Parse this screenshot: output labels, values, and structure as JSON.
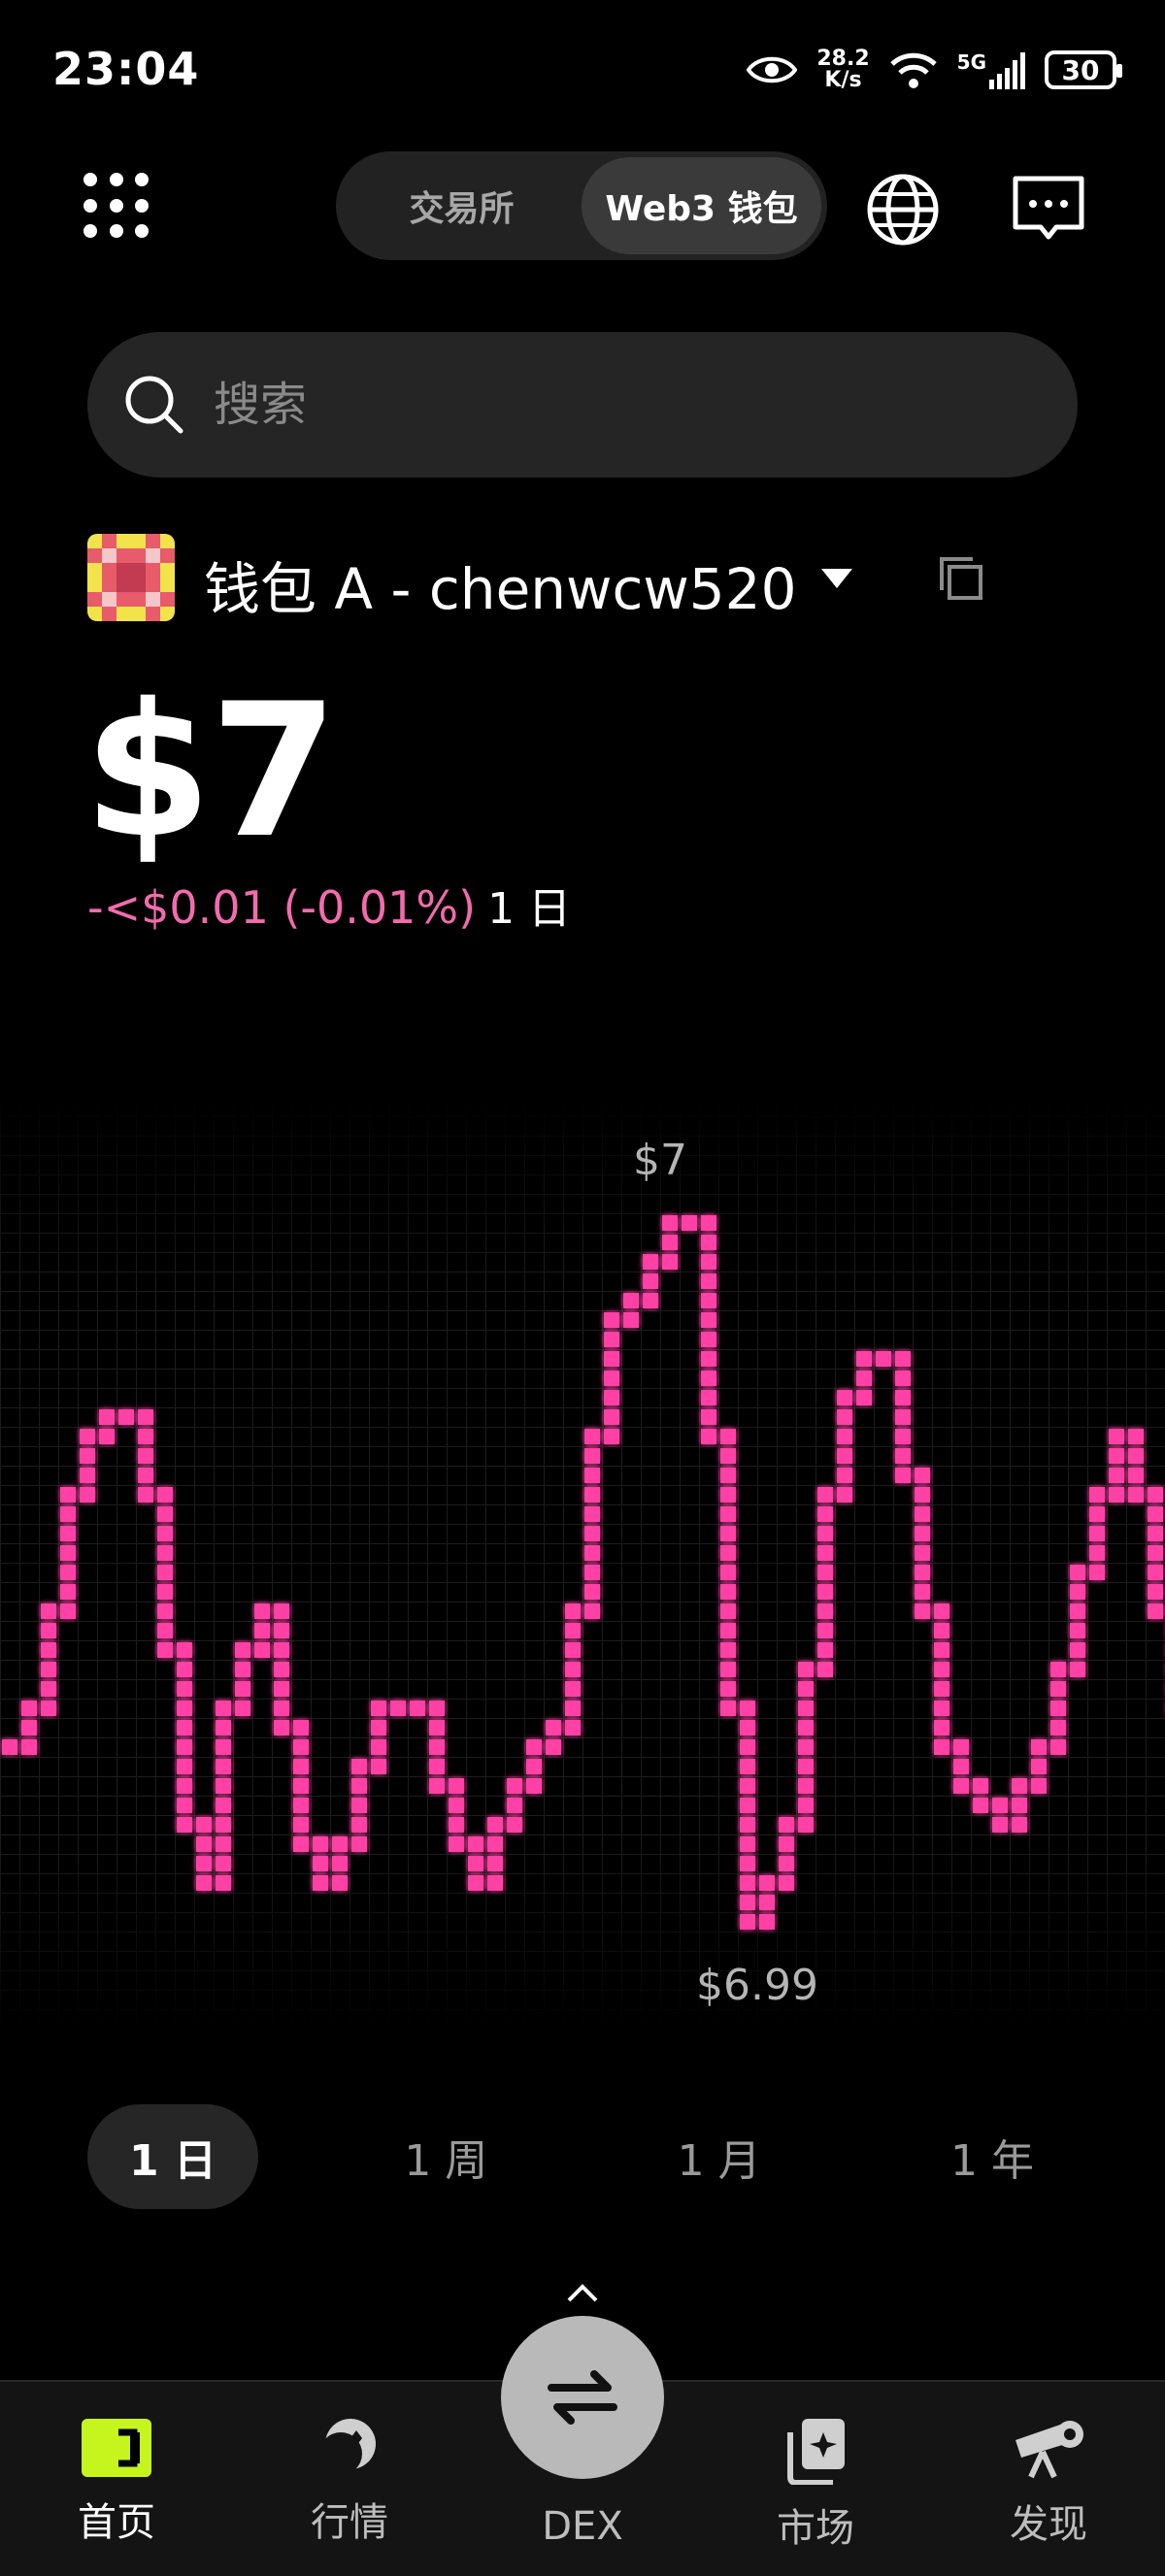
{
  "status_bar": {
    "time": "23:04",
    "net_speed_value": "28.2",
    "net_speed_unit": "K/s",
    "network": "5G",
    "battery": "30"
  },
  "top_bar": {
    "tabs": [
      {
        "label": "交易所",
        "active": false
      },
      {
        "label": "Web3 钱包",
        "active": true
      }
    ]
  },
  "search": {
    "placeholder": "搜索"
  },
  "wallet": {
    "name": "钱包 A - chenwcw520"
  },
  "balance": {
    "amount": "$7",
    "change": "-<$0.01 (-0.01%)",
    "period": "1 日"
  },
  "chart_data": {
    "type": "line",
    "title": "",
    "high_label": "$7",
    "low_label": "$6.99",
    "line_color": "#ff3fa4",
    "points": [
      0.25,
      0.3,
      0.45,
      0.6,
      0.7,
      0.72,
      0.72,
      0.6,
      0.4,
      0.15,
      0.05,
      0.3,
      0.4,
      0.45,
      0.28,
      0.12,
      0.05,
      0.12,
      0.22,
      0.3,
      0.3,
      0.3,
      0.2,
      0.1,
      0.05,
      0.15,
      0.2,
      0.25,
      0.28,
      0.45,
      0.7,
      0.85,
      0.9,
      0.95,
      1.0,
      1.0,
      0.7,
      0.3,
      0.0,
      0.05,
      0.15,
      0.35,
      0.6,
      0.75,
      0.8,
      0.8,
      0.65,
      0.45,
      0.25,
      0.2,
      0.18,
      0.15,
      0.2,
      0.25,
      0.35,
      0.5,
      0.62,
      0.7,
      0.62,
      0.45,
      0.3
    ]
  },
  "range_tabs": [
    {
      "label": "1 日",
      "active": true
    },
    {
      "label": "1 周",
      "active": false
    },
    {
      "label": "1 月",
      "active": false
    },
    {
      "label": "1 年",
      "active": false
    }
  ],
  "bottom_nav": [
    {
      "label": "首页",
      "icon": "wallet-icon",
      "active": true
    },
    {
      "label": "行情",
      "icon": "market-icon",
      "active": false
    },
    {
      "label": "DEX",
      "icon": "swap-icon",
      "active": false
    },
    {
      "label": "市场",
      "icon": "nft-icon",
      "active": false
    },
    {
      "label": "发现",
      "icon": "telescope-icon",
      "active": false
    }
  ],
  "colors": {
    "accent": "#ff3fa4",
    "background": "#000000",
    "wallet_icon": "#c6f51e"
  }
}
